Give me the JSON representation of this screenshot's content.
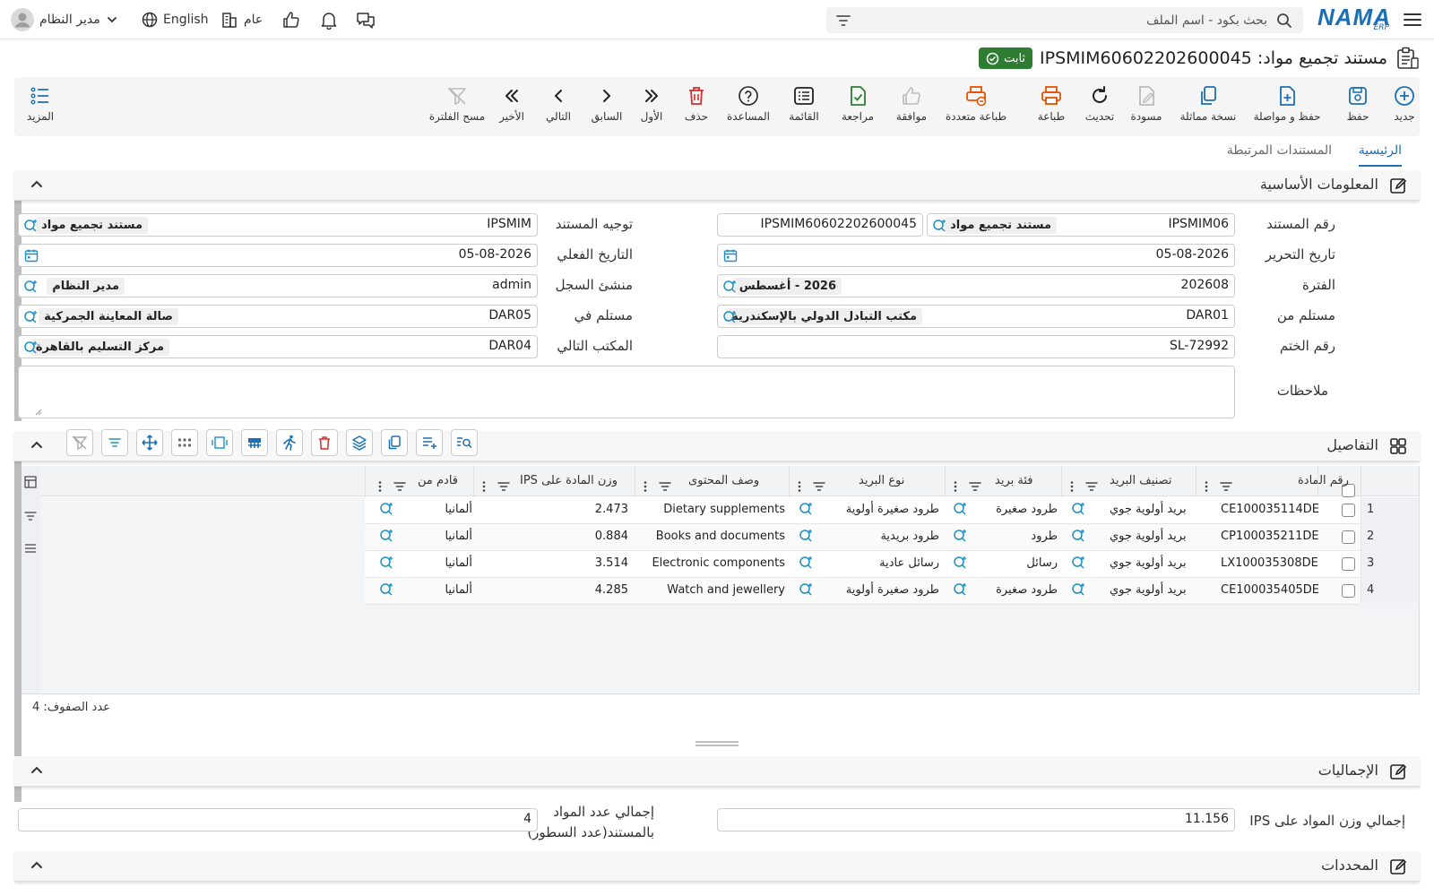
{
  "header": {
    "logo_text": "NAMA",
    "logo_sub": "ERP",
    "search_placeholder": "بحث بكود - اسم الملف",
    "user_name": "مدير النظام",
    "language": "English",
    "scope": "عام"
  },
  "document": {
    "title": "مستند تجميع مواد: IPSMIM60602202600045",
    "status": "ثابت"
  },
  "toolbar": {
    "new": "جديد",
    "save": "حفظ",
    "save_continue": "حفظ و مواصلة",
    "duplicate": "نسخة مماثلة",
    "draft": "مسودة",
    "refresh": "تحديث",
    "print": "طباعة",
    "multi_print": "طباعة متعددة",
    "approve": "موافقة",
    "review": "مراجعة",
    "list": "القائمة",
    "help": "المساعدة",
    "delete": "حذف",
    "first": "الأول",
    "previous": "السابق",
    "next": "التالي",
    "last": "الأخير",
    "clear_filter": "مسح الفلترة",
    "more": "المزيد"
  },
  "tabs": {
    "main": "الرئيسية",
    "related": "المستندات المرتبطة"
  },
  "basic_info": {
    "section_title": "المعلومات الأساسية",
    "doc_number_label": "رقم المستند",
    "doc_number_prefix": "IPSMIM06",
    "doc_number_type": "مستند تجميع مواد",
    "doc_number_value": "IPSMIM60602202600045",
    "direction_label": "توجيه المستند",
    "direction_code": "IPSMIM",
    "direction_name": "مستند تجميع مواد",
    "issue_date_label": "تاريخ التحرير",
    "issue_date": "05-08-2026",
    "actual_date_label": "التاريخ الفعلي",
    "actual_date": "05-08-2026",
    "period_label": "الفترة",
    "period_code": "202608",
    "period_name": "2026 - أغسطس",
    "creator_label": "منشئ السجل",
    "creator_code": "admin",
    "creator_name": "مدير النظام",
    "received_from_label": "مستلم من",
    "received_from_code": "DAR01",
    "received_from_name": "مكتب التبادل الدولي بالإسكندرية",
    "received_in_label": "مستلم في",
    "received_in_code": "DAR05",
    "received_in_name": "صالة المعاينة الجمركية",
    "seal_label": "رقم الختم",
    "seal_value": "SL-72992",
    "next_office_label": "المكتب التالي",
    "next_office_code": "DAR04",
    "next_office_name": "مركز التسليم بالقاهرة",
    "notes_label": "ملاحظات",
    "notes_value": ""
  },
  "details": {
    "section_title": "التفاصيل",
    "columns": {
      "item_no": "رقم المادة",
      "mail_class": "تصنيف البريد",
      "mail_category": "فئة بريد",
      "mail_type": "نوع البريد",
      "content": "وصف المحتوى",
      "weight": "وزن المادة على IPS",
      "origin": "قادم من"
    },
    "rows": [
      {
        "num": "1",
        "item_no": "CE100035114DE",
        "mail_class": "بريد أولوية جوي",
        "mail_category": "طرود صغيرة",
        "mail_type": "طرود صغيرة أولوية",
        "content": "Dietary supplements",
        "weight": "2.473",
        "origin": "ألمانيا"
      },
      {
        "num": "2",
        "item_no": "CP100035211DE",
        "mail_class": "بريد أولوية جوي",
        "mail_category": "طرود",
        "mail_type": "طرود بريدية",
        "content": "Books and documents",
        "weight": "0.884",
        "origin": "ألمانيا"
      },
      {
        "num": "3",
        "item_no": "LX100035308DE",
        "mail_class": "بريد أولوية جوي",
        "mail_category": "رسائل",
        "mail_type": "رسائل عادية",
        "content": "Electronic components",
        "weight": "3.514",
        "origin": "ألمانيا"
      },
      {
        "num": "4",
        "item_no": "CE100035405DE",
        "mail_class": "بريد أولوية جوي",
        "mail_category": "طرود صغيرة",
        "mail_type": "طرود صغيرة أولوية",
        "content": "Watch and jewellery",
        "weight": "4.285",
        "origin": "ألمانيا"
      }
    ],
    "row_count_label": "عدد الصفوف: 4"
  },
  "totals": {
    "section_title": "الإجماليات",
    "total_weight_label": "إجمالي وزن المواد على IPS",
    "total_weight": "11.156",
    "total_count_label_1": "إجمالي عدد المواد",
    "total_count_label_2": "بالمستند(عدد السطور)",
    "total_count": "4"
  },
  "selectors": {
    "section_title": "المحددات"
  },
  "colors": {
    "primary": "#1a6fb5",
    "success": "#2e7d32",
    "danger": "#d32f2f",
    "orange": "#e65100",
    "green": "#2e7d32"
  }
}
